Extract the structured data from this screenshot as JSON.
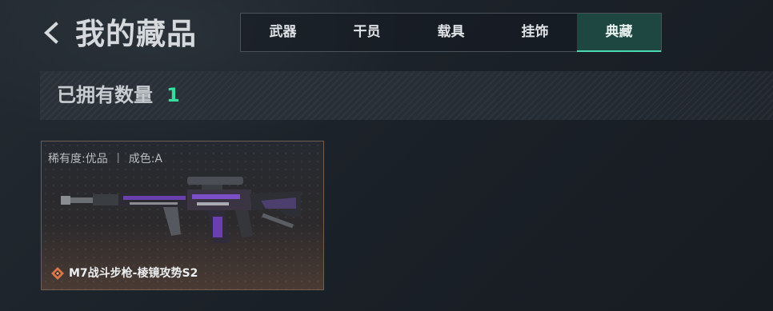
{
  "header": {
    "title": "我的藏品"
  },
  "tabs": [
    {
      "label": "武器",
      "active": false
    },
    {
      "label": "干员",
      "active": false
    },
    {
      "label": "载具",
      "active": false
    },
    {
      "label": "挂饰",
      "active": false
    },
    {
      "label": "典藏",
      "active": true
    }
  ],
  "owned": {
    "label": "已拥有数量",
    "count": "1"
  },
  "items": [
    {
      "rarity": "稀有度:优品",
      "separator": "丨",
      "condition": "成色:A",
      "name": "M7战斗步枪-棱镜攻势S2",
      "icon": "rarity-diamond-icon"
    }
  ],
  "colors": {
    "accent": "#36dca0",
    "active_tab": "#1d4740",
    "background": "#1b2128",
    "rarity_orange": "#d9774a",
    "weapon_purple": "#6a3fb0"
  }
}
